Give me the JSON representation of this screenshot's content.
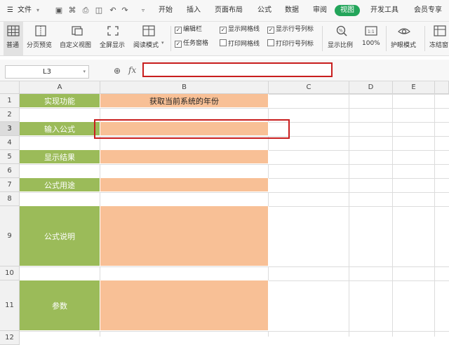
{
  "menubar": {
    "file_label": "文件",
    "tabs": [
      "开始",
      "插入",
      "页面布局",
      "公式",
      "数据",
      "审阅",
      "视图",
      "开发工具",
      "会员专享"
    ],
    "active_tab": "视图"
  },
  "toolbar": {
    "normal": "普通",
    "page_break_preview": "分页预览",
    "custom_view": "自定义视图",
    "full_screen": "全屏显示",
    "reading_mode": "阅读模式",
    "checkboxes": [
      {
        "label": "编辑栏",
        "checked": true
      },
      {
        "label": "显示网格线",
        "checked": true
      },
      {
        "label": "显示行号列标",
        "checked": true
      },
      {
        "label": "任务窗格",
        "checked": true
      },
      {
        "label": "打印网格线",
        "checked": false
      },
      {
        "label": "打印行号列标",
        "checked": false
      }
    ],
    "zoom_ratio": "显示比例",
    "zoom_100": "100%",
    "eye_mode": "护眼模式",
    "freeze": "冻结窗"
  },
  "formula_bar": {
    "name_box": "L3",
    "fx_label": "fx",
    "value": ""
  },
  "columns": [
    "A",
    "B",
    "C",
    "D",
    "E"
  ],
  "rows": [
    "1",
    "2",
    "3",
    "4",
    "5",
    "6",
    "7",
    "8",
    "9",
    "10",
    "11",
    "12"
  ],
  "cells": {
    "A1": "实现功能",
    "B1": "获取当前系统的年份",
    "A3": "输入公式",
    "B3": "",
    "A5": "显示结果",
    "A7": "公式用途",
    "A9": "公式说明",
    "A11": "参数"
  },
  "colors": {
    "label_fill": "#9bbb59",
    "value_fill": "#f8c096",
    "highlight": "#c81e1e",
    "active_tab": "#23a55a"
  }
}
